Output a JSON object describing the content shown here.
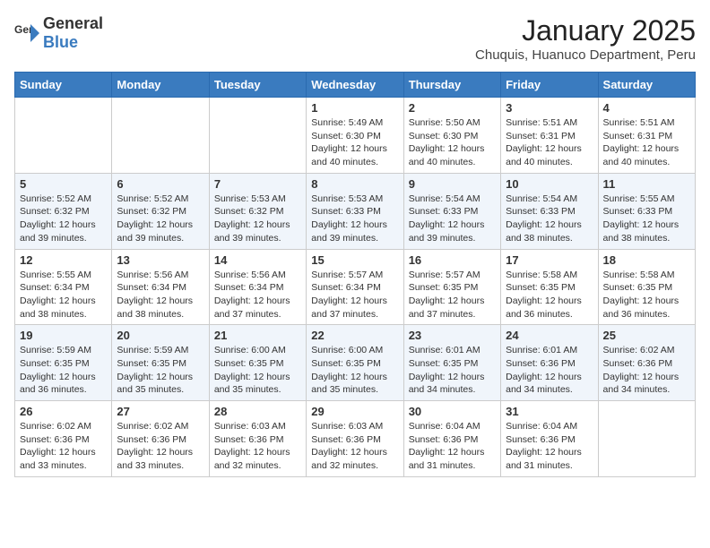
{
  "header": {
    "logo_general": "General",
    "logo_blue": "Blue",
    "month_title": "January 2025",
    "location": "Chuquis, Huanuco Department, Peru"
  },
  "weekdays": [
    "Sunday",
    "Monday",
    "Tuesday",
    "Wednesday",
    "Thursday",
    "Friday",
    "Saturday"
  ],
  "weeks": [
    [
      {
        "day": "",
        "sunrise": "",
        "sunset": "",
        "daylight": ""
      },
      {
        "day": "",
        "sunrise": "",
        "sunset": "",
        "daylight": ""
      },
      {
        "day": "",
        "sunrise": "",
        "sunset": "",
        "daylight": ""
      },
      {
        "day": "1",
        "sunrise": "Sunrise: 5:49 AM",
        "sunset": "Sunset: 6:30 PM",
        "daylight": "Daylight: 12 hours and 40 minutes."
      },
      {
        "day": "2",
        "sunrise": "Sunrise: 5:50 AM",
        "sunset": "Sunset: 6:30 PM",
        "daylight": "Daylight: 12 hours and 40 minutes."
      },
      {
        "day": "3",
        "sunrise": "Sunrise: 5:51 AM",
        "sunset": "Sunset: 6:31 PM",
        "daylight": "Daylight: 12 hours and 40 minutes."
      },
      {
        "day": "4",
        "sunrise": "Sunrise: 5:51 AM",
        "sunset": "Sunset: 6:31 PM",
        "daylight": "Daylight: 12 hours and 40 minutes."
      }
    ],
    [
      {
        "day": "5",
        "sunrise": "Sunrise: 5:52 AM",
        "sunset": "Sunset: 6:32 PM",
        "daylight": "Daylight: 12 hours and 39 minutes."
      },
      {
        "day": "6",
        "sunrise": "Sunrise: 5:52 AM",
        "sunset": "Sunset: 6:32 PM",
        "daylight": "Daylight: 12 hours and 39 minutes."
      },
      {
        "day": "7",
        "sunrise": "Sunrise: 5:53 AM",
        "sunset": "Sunset: 6:32 PM",
        "daylight": "Daylight: 12 hours and 39 minutes."
      },
      {
        "day": "8",
        "sunrise": "Sunrise: 5:53 AM",
        "sunset": "Sunset: 6:33 PM",
        "daylight": "Daylight: 12 hours and 39 minutes."
      },
      {
        "day": "9",
        "sunrise": "Sunrise: 5:54 AM",
        "sunset": "Sunset: 6:33 PM",
        "daylight": "Daylight: 12 hours and 39 minutes."
      },
      {
        "day": "10",
        "sunrise": "Sunrise: 5:54 AM",
        "sunset": "Sunset: 6:33 PM",
        "daylight": "Daylight: 12 hours and 38 minutes."
      },
      {
        "day": "11",
        "sunrise": "Sunrise: 5:55 AM",
        "sunset": "Sunset: 6:33 PM",
        "daylight": "Daylight: 12 hours and 38 minutes."
      }
    ],
    [
      {
        "day": "12",
        "sunrise": "Sunrise: 5:55 AM",
        "sunset": "Sunset: 6:34 PM",
        "daylight": "Daylight: 12 hours and 38 minutes."
      },
      {
        "day": "13",
        "sunrise": "Sunrise: 5:56 AM",
        "sunset": "Sunset: 6:34 PM",
        "daylight": "Daylight: 12 hours and 38 minutes."
      },
      {
        "day": "14",
        "sunrise": "Sunrise: 5:56 AM",
        "sunset": "Sunset: 6:34 PM",
        "daylight": "Daylight: 12 hours and 37 minutes."
      },
      {
        "day": "15",
        "sunrise": "Sunrise: 5:57 AM",
        "sunset": "Sunset: 6:34 PM",
        "daylight": "Daylight: 12 hours and 37 minutes."
      },
      {
        "day": "16",
        "sunrise": "Sunrise: 5:57 AM",
        "sunset": "Sunset: 6:35 PM",
        "daylight": "Daylight: 12 hours and 37 minutes."
      },
      {
        "day": "17",
        "sunrise": "Sunrise: 5:58 AM",
        "sunset": "Sunset: 6:35 PM",
        "daylight": "Daylight: 12 hours and 36 minutes."
      },
      {
        "day": "18",
        "sunrise": "Sunrise: 5:58 AM",
        "sunset": "Sunset: 6:35 PM",
        "daylight": "Daylight: 12 hours and 36 minutes."
      }
    ],
    [
      {
        "day": "19",
        "sunrise": "Sunrise: 5:59 AM",
        "sunset": "Sunset: 6:35 PM",
        "daylight": "Daylight: 12 hours and 36 minutes."
      },
      {
        "day": "20",
        "sunrise": "Sunrise: 5:59 AM",
        "sunset": "Sunset: 6:35 PM",
        "daylight": "Daylight: 12 hours and 35 minutes."
      },
      {
        "day": "21",
        "sunrise": "Sunrise: 6:00 AM",
        "sunset": "Sunset: 6:35 PM",
        "daylight": "Daylight: 12 hours and 35 minutes."
      },
      {
        "day": "22",
        "sunrise": "Sunrise: 6:00 AM",
        "sunset": "Sunset: 6:35 PM",
        "daylight": "Daylight: 12 hours and 35 minutes."
      },
      {
        "day": "23",
        "sunrise": "Sunrise: 6:01 AM",
        "sunset": "Sunset: 6:35 PM",
        "daylight": "Daylight: 12 hours and 34 minutes."
      },
      {
        "day": "24",
        "sunrise": "Sunrise: 6:01 AM",
        "sunset": "Sunset: 6:36 PM",
        "daylight": "Daylight: 12 hours and 34 minutes."
      },
      {
        "day": "25",
        "sunrise": "Sunrise: 6:02 AM",
        "sunset": "Sunset: 6:36 PM",
        "daylight": "Daylight: 12 hours and 34 minutes."
      }
    ],
    [
      {
        "day": "26",
        "sunrise": "Sunrise: 6:02 AM",
        "sunset": "Sunset: 6:36 PM",
        "daylight": "Daylight: 12 hours and 33 minutes."
      },
      {
        "day": "27",
        "sunrise": "Sunrise: 6:02 AM",
        "sunset": "Sunset: 6:36 PM",
        "daylight": "Daylight: 12 hours and 33 minutes."
      },
      {
        "day": "28",
        "sunrise": "Sunrise: 6:03 AM",
        "sunset": "Sunset: 6:36 PM",
        "daylight": "Daylight: 12 hours and 32 minutes."
      },
      {
        "day": "29",
        "sunrise": "Sunrise: 6:03 AM",
        "sunset": "Sunset: 6:36 PM",
        "daylight": "Daylight: 12 hours and 32 minutes."
      },
      {
        "day": "30",
        "sunrise": "Sunrise: 6:04 AM",
        "sunset": "Sunset: 6:36 PM",
        "daylight": "Daylight: 12 hours and 31 minutes."
      },
      {
        "day": "31",
        "sunrise": "Sunrise: 6:04 AM",
        "sunset": "Sunset: 6:36 PM",
        "daylight": "Daylight: 12 hours and 31 minutes."
      },
      {
        "day": "",
        "sunrise": "",
        "sunset": "",
        "daylight": ""
      }
    ]
  ]
}
